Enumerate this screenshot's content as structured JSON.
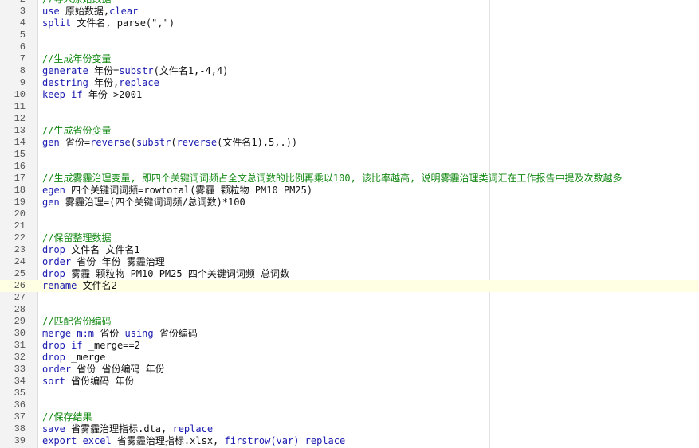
{
  "editor": {
    "current_line": 26,
    "lines": [
      {
        "n": "2",
        "tokens": [
          {
            "t": "cmt",
            "v": "//导入原始数据"
          }
        ]
      },
      {
        "n": "3",
        "tokens": [
          {
            "t": "kw",
            "v": "use"
          },
          {
            "t": "txt",
            "v": " 原始数据,"
          },
          {
            "t": "kw",
            "v": "clear"
          }
        ]
      },
      {
        "n": "4",
        "tokens": [
          {
            "t": "kw",
            "v": "split"
          },
          {
            "t": "txt",
            "v": " 文件名, parse(\",\")"
          }
        ]
      },
      {
        "n": "5",
        "tokens": []
      },
      {
        "n": "6",
        "tokens": []
      },
      {
        "n": "7",
        "tokens": [
          {
            "t": "cmt",
            "v": "//生成年份变量"
          }
        ]
      },
      {
        "n": "8",
        "tokens": [
          {
            "t": "kw",
            "v": "generate"
          },
          {
            "t": "txt",
            "v": " 年份="
          },
          {
            "t": "fn",
            "v": "substr"
          },
          {
            "t": "txt",
            "v": "(文件名1,-4,4)"
          }
        ]
      },
      {
        "n": "9",
        "tokens": [
          {
            "t": "kw",
            "v": "destring"
          },
          {
            "t": "txt",
            "v": " 年份,"
          },
          {
            "t": "kw",
            "v": "replace"
          }
        ]
      },
      {
        "n": "10",
        "tokens": [
          {
            "t": "kw",
            "v": "keep"
          },
          {
            "t": "txt",
            "v": " "
          },
          {
            "t": "kw",
            "v": "if"
          },
          {
            "t": "txt",
            "v": " 年份 >2001"
          }
        ]
      },
      {
        "n": "11",
        "tokens": []
      },
      {
        "n": "12",
        "tokens": []
      },
      {
        "n": "13",
        "tokens": [
          {
            "t": "cmt",
            "v": "//生成省份变量"
          }
        ]
      },
      {
        "n": "14",
        "tokens": [
          {
            "t": "kw",
            "v": "gen"
          },
          {
            "t": "txt",
            "v": " 省份="
          },
          {
            "t": "fn",
            "v": "reverse"
          },
          {
            "t": "txt",
            "v": "("
          },
          {
            "t": "fn",
            "v": "substr"
          },
          {
            "t": "txt",
            "v": "("
          },
          {
            "t": "fn",
            "v": "reverse"
          },
          {
            "t": "txt",
            "v": "(文件名1),5,.))"
          }
        ]
      },
      {
        "n": "15",
        "tokens": []
      },
      {
        "n": "16",
        "tokens": []
      },
      {
        "n": "17",
        "tokens": [
          {
            "t": "cmt",
            "v": "//生成雾霾治理变量, 即四个关键词词频占全文总词数的比例再乘以100, 该比率越高, 说明雾霾治理类词汇在工作报告中提及次数越多"
          }
        ]
      },
      {
        "n": "18",
        "tokens": [
          {
            "t": "kw",
            "v": "egen"
          },
          {
            "t": "txt",
            "v": " 四个关键词词频=rowtotal(雾霾 颗粒物 PM10 PM25)"
          }
        ]
      },
      {
        "n": "19",
        "tokens": [
          {
            "t": "kw",
            "v": "gen"
          },
          {
            "t": "txt",
            "v": " 雾霾治理=(四个关键词词频/总词数)*100"
          }
        ]
      },
      {
        "n": "20",
        "tokens": []
      },
      {
        "n": "21",
        "tokens": []
      },
      {
        "n": "22",
        "tokens": [
          {
            "t": "cmt",
            "v": "//保留整理数据"
          }
        ]
      },
      {
        "n": "23",
        "tokens": [
          {
            "t": "kw",
            "v": "drop"
          },
          {
            "t": "txt",
            "v": " 文件名 文件名1"
          }
        ]
      },
      {
        "n": "24",
        "tokens": [
          {
            "t": "kw",
            "v": "order"
          },
          {
            "t": "txt",
            "v": " 省份 年份 雾霾治理"
          }
        ]
      },
      {
        "n": "25",
        "tokens": [
          {
            "t": "kw",
            "v": "drop"
          },
          {
            "t": "txt",
            "v": " 雾霾 颗粒物 PM10 PM25 四个关键词词频 总词数"
          }
        ]
      },
      {
        "n": "26",
        "tokens": [
          {
            "t": "kw",
            "v": "rename"
          },
          {
            "t": "txt",
            "v": " 文件名2"
          }
        ]
      },
      {
        "n": "27",
        "tokens": []
      },
      {
        "n": "28",
        "tokens": []
      },
      {
        "n": "29",
        "tokens": [
          {
            "t": "cmt",
            "v": "//匹配省份编码"
          }
        ]
      },
      {
        "n": "30",
        "tokens": [
          {
            "t": "kw",
            "v": "merge"
          },
          {
            "t": "txt",
            "v": " "
          },
          {
            "t": "kw",
            "v": "m:m"
          },
          {
            "t": "txt",
            "v": " 省份 "
          },
          {
            "t": "kw",
            "v": "using"
          },
          {
            "t": "txt",
            "v": " 省份编码"
          }
        ]
      },
      {
        "n": "31",
        "tokens": [
          {
            "t": "kw",
            "v": "drop"
          },
          {
            "t": "txt",
            "v": " "
          },
          {
            "t": "kw",
            "v": "if"
          },
          {
            "t": "txt",
            "v": " _merge==2"
          }
        ]
      },
      {
        "n": "32",
        "tokens": [
          {
            "t": "kw",
            "v": "drop"
          },
          {
            "t": "txt",
            "v": " _merge"
          }
        ]
      },
      {
        "n": "33",
        "tokens": [
          {
            "t": "kw",
            "v": "order"
          },
          {
            "t": "txt",
            "v": " 省份 省份编码 年份"
          }
        ]
      },
      {
        "n": "34",
        "tokens": [
          {
            "t": "kw",
            "v": "sort"
          },
          {
            "t": "txt",
            "v": " 省份编码 年份"
          }
        ]
      },
      {
        "n": "35",
        "tokens": []
      },
      {
        "n": "36",
        "tokens": []
      },
      {
        "n": "37",
        "tokens": [
          {
            "t": "cmt",
            "v": "//保存结果"
          }
        ]
      },
      {
        "n": "38",
        "tokens": [
          {
            "t": "kw",
            "v": "save"
          },
          {
            "t": "txt",
            "v": " 省雾霾治理指标.dta, "
          },
          {
            "t": "kw",
            "v": "replace"
          }
        ]
      },
      {
        "n": "39",
        "tokens": [
          {
            "t": "kw",
            "v": "export excel"
          },
          {
            "t": "txt",
            "v": " 省雾霾治理指标.xlsx, "
          },
          {
            "t": "kw",
            "v": "firstrow(var) replace"
          }
        ]
      }
    ]
  }
}
